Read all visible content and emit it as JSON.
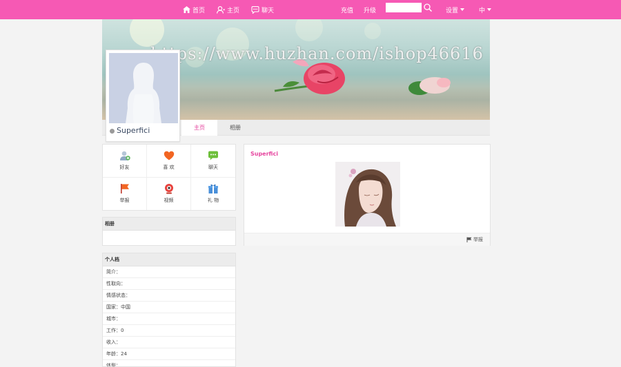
{
  "nav": {
    "home": "首页",
    "profile": "主页",
    "chat": "聊天",
    "recharge": "充值",
    "upgrade": "升级",
    "search_placeholder": "",
    "settings": "设置",
    "language": "中"
  },
  "banner": {
    "watermark": "https://www.huzhan.com/ishop46616"
  },
  "tabs": [
    {
      "label": "主页",
      "active": true
    },
    {
      "label": "相册",
      "active": false
    }
  ],
  "user": {
    "name": "Superfici",
    "status": "offline"
  },
  "actions": [
    {
      "label": "好友",
      "icon": "add-friend-icon"
    },
    {
      "label": "喜 欢",
      "icon": "heart-icon"
    },
    {
      "label": "聊天",
      "icon": "chat-bubble-icon"
    },
    {
      "label": "举报",
      "icon": "flag-icon"
    },
    {
      "label": "视频",
      "icon": "webcam-icon"
    },
    {
      "label": "礼 物",
      "icon": "gift-icon"
    }
  ],
  "album_panel": {
    "title": "相册"
  },
  "info_panel": {
    "title": "个人档",
    "rows": [
      "简介：",
      "性取向：",
      "情感状态：",
      "国家：中国",
      "城市：",
      "工作：0",
      "收入：",
      "年龄：24",
      "体型："
    ]
  },
  "post": {
    "author": "Superfici",
    "report": "举报"
  },
  "colors": {
    "topbar": "#f659b4",
    "accent_pink": "#e6469f",
    "page_bg": "#f3f3f3"
  }
}
